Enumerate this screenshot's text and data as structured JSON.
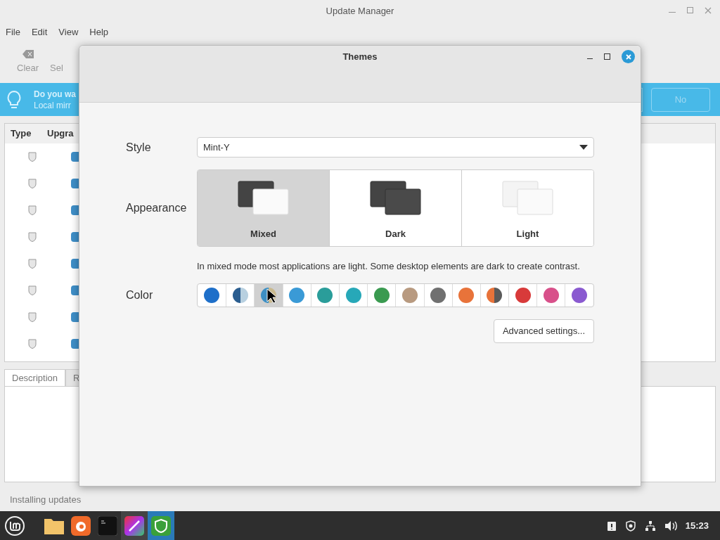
{
  "background_window": {
    "title": "Update Manager",
    "menu": [
      "File",
      "Edit",
      "View",
      "Help"
    ],
    "toolbar": [
      {
        "label": "Clear"
      },
      {
        "label": "Sel"
      }
    ],
    "banner": {
      "title": "Do you wa",
      "subtitle": "Local mirr",
      "button": "No"
    },
    "table": {
      "columns": [
        "Type",
        "Upgra"
      ],
      "rows": [
        {
          "checked": true
        },
        {
          "checked": true
        },
        {
          "checked": true
        },
        {
          "checked": true
        },
        {
          "checked": true
        },
        {
          "checked": true
        },
        {
          "checked": true
        },
        {
          "checked": true
        }
      ]
    },
    "tabs": [
      {
        "label": "Description",
        "selected": true
      },
      {
        "label": "R",
        "selected": false
      }
    ],
    "status": "Installing updates"
  },
  "dialog": {
    "title": "Themes",
    "style": {
      "label": "Style",
      "value": "Mint-Y"
    },
    "appearance": {
      "label": "Appearance",
      "options": [
        {
          "label": "Mixed",
          "kind": "mixed",
          "selected": true
        },
        {
          "label": "Dark",
          "kind": "dark",
          "selected": false
        },
        {
          "label": "Light",
          "kind": "light",
          "selected": false
        }
      ],
      "description": "In mixed mode most applications are light. Some desktop elements are dark to create contrast."
    },
    "color": {
      "label": "Color",
      "swatches": [
        {
          "color": "#1e6fc9",
          "selected": false
        },
        {
          "kind": "split",
          "halves": [
            {
              "color": "#2a5d8f"
            },
            {
              "color": "#b8d0e0"
            }
          ],
          "selected": false
        },
        {
          "kind": "split",
          "halves": [
            {
              "color": "#3d8fc4"
            },
            {
              "color": "#c9b98e"
            }
          ],
          "selected": true
        },
        {
          "color": "#3a9ad6",
          "selected": false
        },
        {
          "color": "#2a9d9a",
          "selected": false
        },
        {
          "color": "#27a8b8",
          "selected": false
        },
        {
          "color": "#3a9a50",
          "selected": false
        },
        {
          "color": "#b89a80",
          "selected": false
        },
        {
          "color": "#707070",
          "selected": false
        },
        {
          "color": "#e8733a",
          "selected": false
        },
        {
          "kind": "split",
          "halves": [
            {
              "color": "#e8733a"
            },
            {
              "color": "#5a5a5a"
            }
          ],
          "selected": false
        },
        {
          "color": "#d83a3a",
          "selected": false
        },
        {
          "color": "#d8508a",
          "selected": false
        },
        {
          "color": "#8a5ad0",
          "selected": false
        }
      ]
    },
    "button": "Advanced settings..."
  },
  "taskbar": {
    "apps": [
      {
        "kind": "files",
        "selected": false
      },
      {
        "kind": "browser",
        "selected": false
      },
      {
        "kind": "terminal",
        "selected": false
      },
      {
        "kind": "paint",
        "selected": true
      },
      {
        "kind": "shield",
        "selected": true
      }
    ],
    "clock": "15:23"
  }
}
